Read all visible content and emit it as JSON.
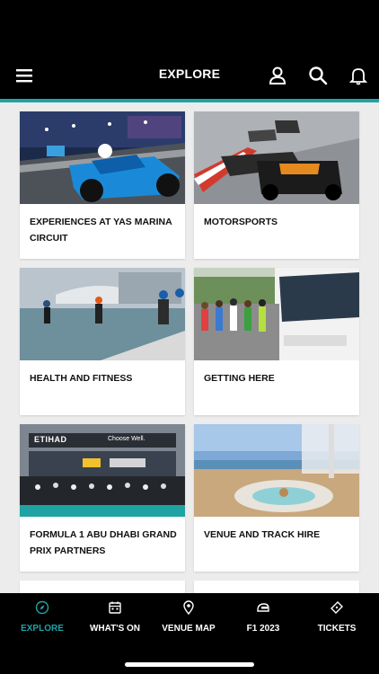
{
  "header": {
    "title": "EXPLORE",
    "icons": [
      "menu-icon",
      "user-icon",
      "search-icon",
      "bell-icon"
    ]
  },
  "cards": [
    {
      "label": "EXPERIENCES AT YAS MARINA CIRCUIT",
      "image": "blue formula car on track at night"
    },
    {
      "label": "MOTORSPORTS",
      "image": "race cars on track"
    },
    {
      "label": "HEALTH AND FITNESS",
      "image": "triathletes running from water"
    },
    {
      "label": "GETTING HERE",
      "image": "people boarding a shuttle bus"
    },
    {
      "label": "FORMULA 1 ABU DHABI GRAND PRIX PARTNERS",
      "image": "crowd on pit lane with ETIHAD banner",
      "banner_text": "ETIHAD",
      "banner_sub": "Choose Well."
    },
    {
      "label": "VENUE AND TRACK HIRE",
      "image": "lounge terrace with sofas"
    }
  ],
  "bottom_nav": [
    {
      "label": "EXPLORE",
      "icon": "compass-icon",
      "active": true
    },
    {
      "label": "WHAT'S ON",
      "icon": "calendar-icon",
      "active": false
    },
    {
      "label": "VENUE MAP",
      "icon": "map-pin-icon",
      "active": false
    },
    {
      "label": "F1 2023",
      "icon": "helmet-icon",
      "active": false
    },
    {
      "label": "TICKETS",
      "icon": "ticket-icon",
      "active": false
    }
  ],
  "colors": {
    "accent": "#1fa3a3",
    "background": "#ececec",
    "bar": "#000000"
  }
}
